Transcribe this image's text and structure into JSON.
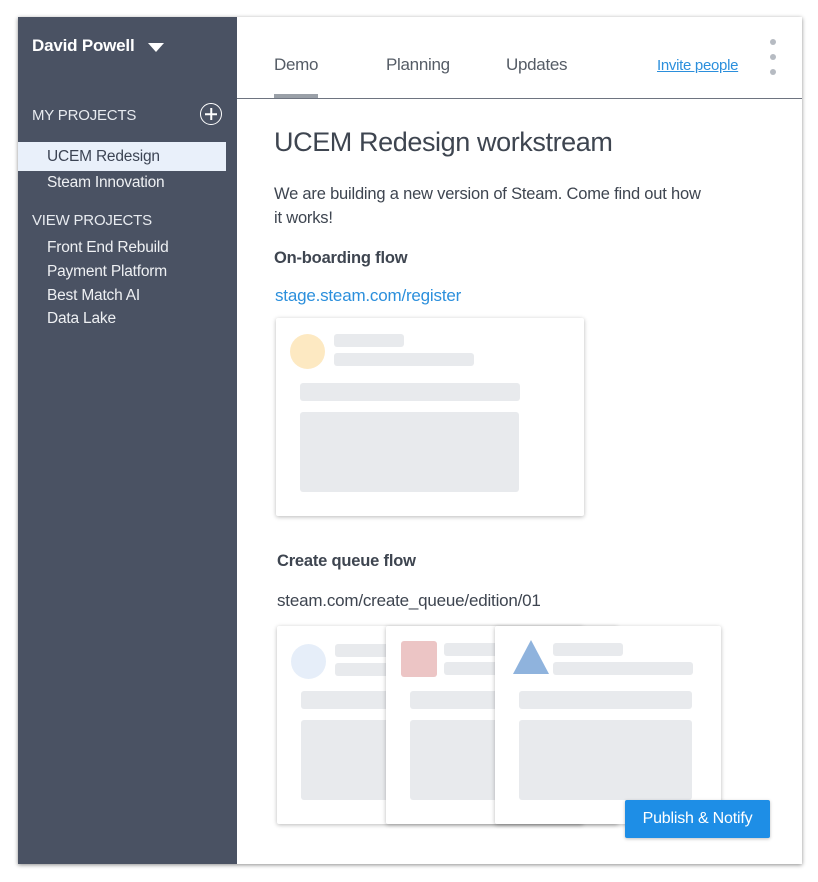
{
  "sidebar": {
    "user_name": "David Powell",
    "my_projects_label": "MY PROJECTS",
    "my_projects": [
      "UCEM Redesign",
      "Steam Innovation"
    ],
    "view_projects_label": "VIEW PROJECTS",
    "view_projects": [
      "Front End Rebuild",
      "Payment Platform",
      "Best Match AI",
      "Data Lake"
    ]
  },
  "tabs": [
    "Demo",
    "Planning",
    "Updates"
  ],
  "invite_label": "Invite people",
  "main": {
    "title": "UCEM Redesign workstream",
    "description": "We are building a new version of Steam. Come find out how it works!",
    "section1": {
      "heading": "On-boarding flow",
      "link": "stage.steam.com/register"
    },
    "section2": {
      "heading": "Create queue flow",
      "link": "steam.com/create_queue/edition/01"
    }
  },
  "publish_label": "Publish & Notify",
  "colors": {
    "sidebar_bg": "#4a5263",
    "accent": "#1e8ee6",
    "link": "#2b8fdc",
    "avatar_yellow": "#fde9c2",
    "avatar_blue": "#e6eef9",
    "avatar_pink": "#ecc5c5",
    "avatar_triangle": "#8fb3dd"
  }
}
